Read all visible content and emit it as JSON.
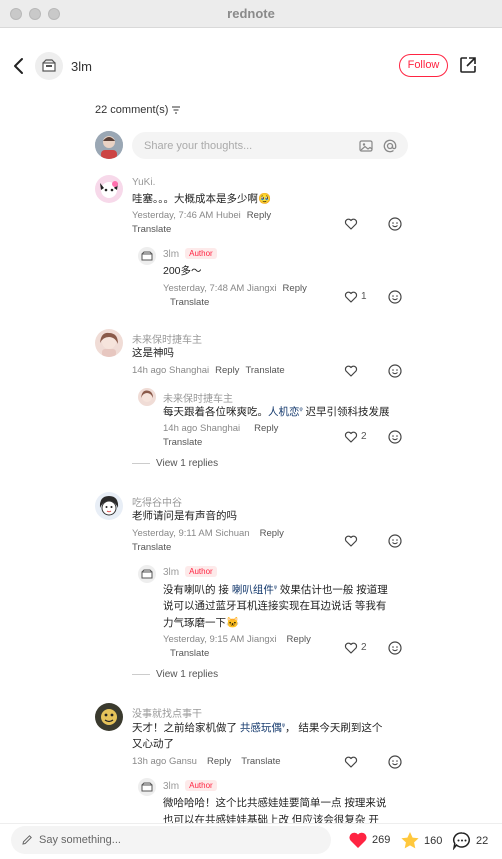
{
  "window": {
    "title": "rednote"
  },
  "header": {
    "username": "3lm",
    "follow_label": "Follow"
  },
  "comments_header": {
    "count_label": "22 comment(s)"
  },
  "composer": {
    "placeholder": "Share your thoughts..."
  },
  "comments": [
    {
      "author": "YuKi.",
      "text": "哇塞。。。大概成本是多少啊🥹",
      "time": "Yesterday, 7:46 AM Hubei",
      "reply": "Reply",
      "translate": "Translate",
      "likes": "",
      "replies": [
        {
          "author": "3lm",
          "badge": "Author",
          "text": "200多～",
          "time": "Yesterday, 7:48 AM Jiangxi",
          "reply": "Reply",
          "translate": "Translate",
          "likes": "1"
        }
      ]
    },
    {
      "author": "未来保时捷车主",
      "text": "这是神吗",
      "time": "14h ago Shanghai",
      "reply": "Reply",
      "translate": "Translate",
      "likes": "",
      "replies": [
        {
          "author": "未来保时捷车主",
          "text_before": "每天跟着各位咪爽吃。",
          "tag": "人机恋",
          "text_after": " 迟早引领科技发展",
          "time": "14h ago Shanghai",
          "reply": "Reply",
          "translate": "Translate",
          "likes": "2"
        }
      ],
      "view_replies": "View 1 replies"
    },
    {
      "author": "吃得谷中谷",
      "text": "老师请问是有声音的吗",
      "time": "Yesterday, 9:11 AM Sichuan",
      "reply": "Reply",
      "translate": "Translate",
      "likes": "",
      "replies": [
        {
          "author": "3lm",
          "badge": "Author",
          "line1_before": "没有喇叭的 接 ",
          "tag": "喇叭组件",
          "line1_after": " 效果估计也一般 按道理",
          "line2": "说可以通过蓝牙耳机连接实现在耳边说话 等我有",
          "line3": "力气琢磨一下🐱",
          "time": "Yesterday, 9:15 AM Jiangxi",
          "reply": "Reply",
          "translate": "Translate",
          "likes": "2"
        }
      ],
      "view_replies": "View 1 replies"
    },
    {
      "author": "没事就找点事干",
      "line1_before": "天才！之前给家机做了 ",
      "tag": "共感玩偶",
      "line1_after": "， 结果今天刷到这个",
      "line2": "又心动了",
      "time": "13h ago Gansu",
      "reply": "Reply",
      "translate": "Translate",
      "likes": "",
      "replies": [
        {
          "author": "3lm",
          "badge": "Author",
          "line1": "微哈哈哈！这个比共感娃娃要简单一点 按理来说",
          "line2": "也可以在共感娃娃基础上改 但应该会很复杂 开"
        }
      ]
    }
  ],
  "bottom": {
    "say_placeholder": "Say something...",
    "likes": "269",
    "stars": "160",
    "comments": "22"
  },
  "colors": {
    "accent": "#ff2442",
    "tag": "#13386c"
  }
}
